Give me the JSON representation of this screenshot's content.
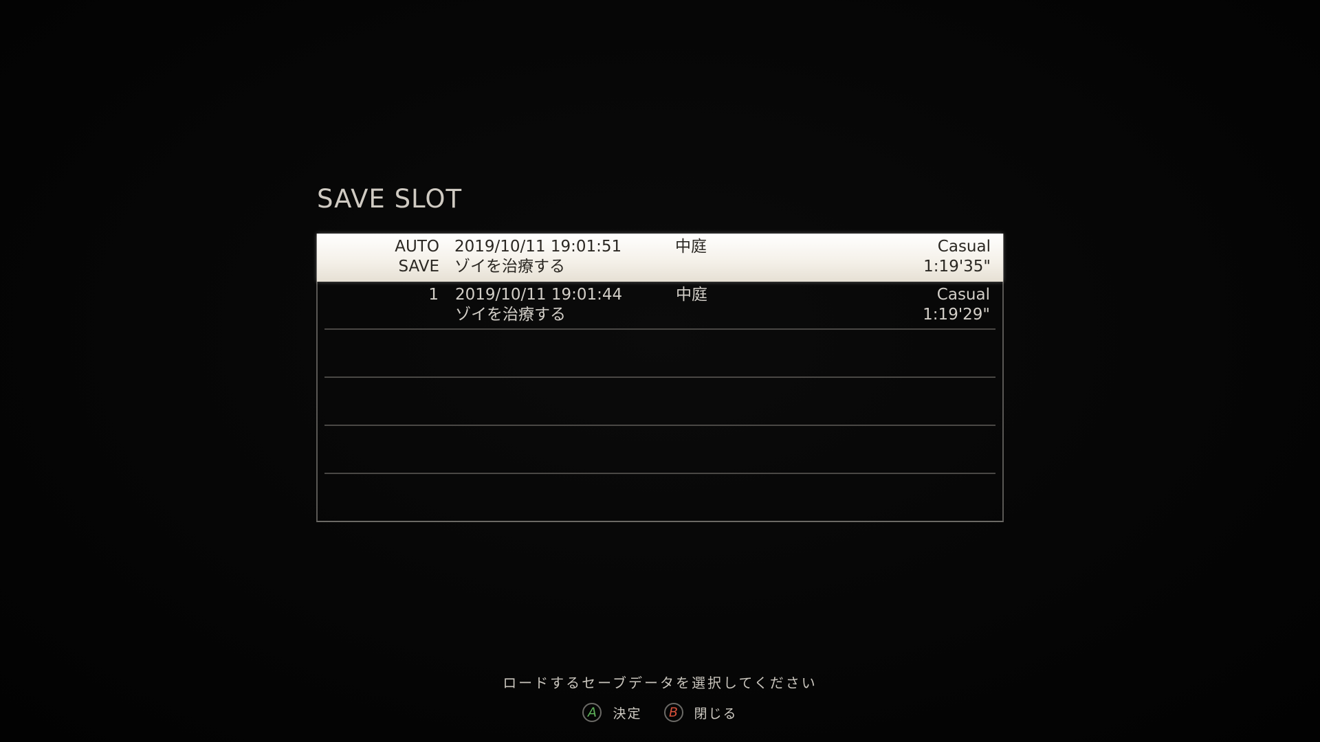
{
  "screen": {
    "title": "SAVE SLOT"
  },
  "slots": [
    {
      "label_line1": "AUTO",
      "label_line2": "SAVE",
      "date": "2019/10/11 19:01:51",
      "location": "中庭",
      "objective": "ゾイを治療する",
      "difficulty": "Casual",
      "playtime": "1:19'35\""
    },
    {
      "label_line1": "1",
      "label_line2": "",
      "date": "2019/10/11 19:01:44",
      "location": "中庭",
      "objective": "ゾイを治療する",
      "difficulty": "Casual",
      "playtime": "1:19'29\""
    }
  ],
  "footer": {
    "prompt": "ロードするセーブデータを選択してください",
    "confirm_button_glyph": "A",
    "confirm_label": "決定",
    "close_button_glyph": "B",
    "close_label": "閉じる"
  },
  "colors": {
    "confirm_button": "#5fb35a",
    "close_button": "#d6503a",
    "selection_highlight": "#f4f0e8"
  },
  "icons": {
    "confirm": "a-button-icon",
    "close": "b-button-icon"
  }
}
